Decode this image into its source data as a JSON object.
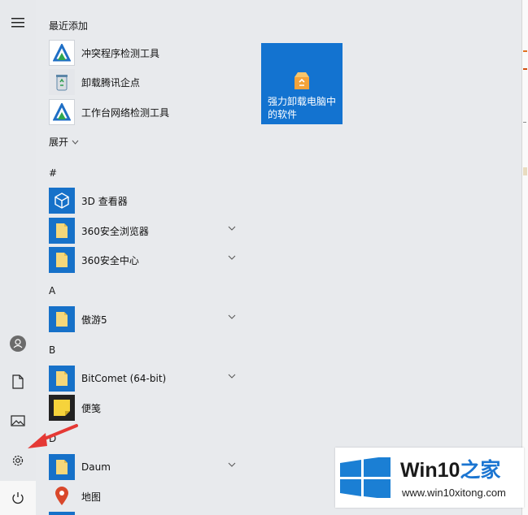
{
  "sidebar": {
    "icons": [
      "hamburger-menu-icon",
      "user-account-icon",
      "documents-icon",
      "pictures-icon",
      "settings-icon",
      "power-icon"
    ]
  },
  "app_list": {
    "recent_header": "最近添加",
    "recent": [
      {
        "label": "冲突程序检测工具",
        "icon": "network-tool-icon"
      },
      {
        "label": "卸载腾讯企点",
        "icon": "recycle-bin-icon"
      },
      {
        "label": "工作台网络检测工具",
        "icon": "network-tool-icon"
      }
    ],
    "expand_label": "展开",
    "groups": [
      {
        "letter": "#",
        "items": [
          {
            "label": "3D 查看器",
            "icon": "cube-icon",
            "has_submenu": false
          },
          {
            "label": "360安全浏览器",
            "icon": "folder-icon",
            "has_submenu": true
          },
          {
            "label": "360安全中心",
            "icon": "folder-icon",
            "has_submenu": true
          }
        ]
      },
      {
        "letter": "A",
        "items": [
          {
            "label": "傲游5",
            "icon": "folder-icon",
            "has_submenu": true
          }
        ]
      },
      {
        "letter": "B",
        "items": [
          {
            "label": "BitComet (64-bit)",
            "icon": "folder-icon",
            "has_submenu": true
          },
          {
            "label": "便笺",
            "icon": "sticky-note-icon",
            "has_submenu": false
          }
        ]
      },
      {
        "letter": "D",
        "items": [
          {
            "label": "Daum",
            "icon": "folder-icon",
            "has_submenu": true
          },
          {
            "label": "地图",
            "icon": "map-pin-icon",
            "has_submenu": false
          }
        ]
      }
    ]
  },
  "tiles": [
    {
      "label": "强力卸载电脑中的软件",
      "icon": "uninstall-box-icon"
    }
  ],
  "watermark": {
    "brand_prefix": "Win10",
    "brand_suffix": "之家",
    "url": "www.win10xitong.com"
  },
  "colors": {
    "tile_blue": "#1373d0",
    "arrow_red": "#e53935",
    "brand_blue": "#1b75d1"
  }
}
